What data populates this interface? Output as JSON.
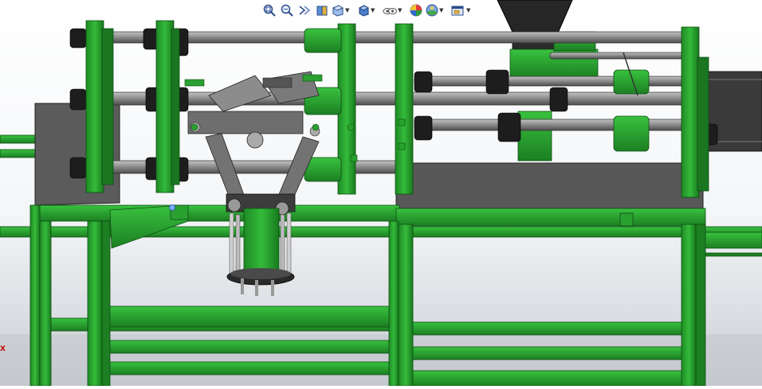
{
  "toolbar": {
    "tools": [
      {
        "icon": "zoom-to-fit-icon"
      },
      {
        "icon": "zoom-to-area-icon"
      },
      {
        "icon": "previous-view-icon"
      },
      {
        "icon": "section-view-icon"
      },
      {
        "icon": "view-orientation-icon",
        "dropdown": true
      },
      {
        "icon": "display-style-icon",
        "dropdown": true
      },
      {
        "icon": "hide-show-items-icon",
        "dropdown": true
      },
      {
        "icon": "edit-appearance-icon"
      },
      {
        "icon": "apply-scene-icon",
        "dropdown": true
      },
      {
        "icon": "view-settings-icon",
        "dropdown": true
      }
    ]
  },
  "viewport": {
    "model": "machine-assembly",
    "colors": {
      "frame_green": "#27a82c",
      "frame_dark": "#12601a",
      "plate_gray": "#5a5a5a",
      "rod_gray": "#8b8b8b",
      "hopper_black": "#262626"
    }
  },
  "triad": {
    "x_label": "X"
  }
}
